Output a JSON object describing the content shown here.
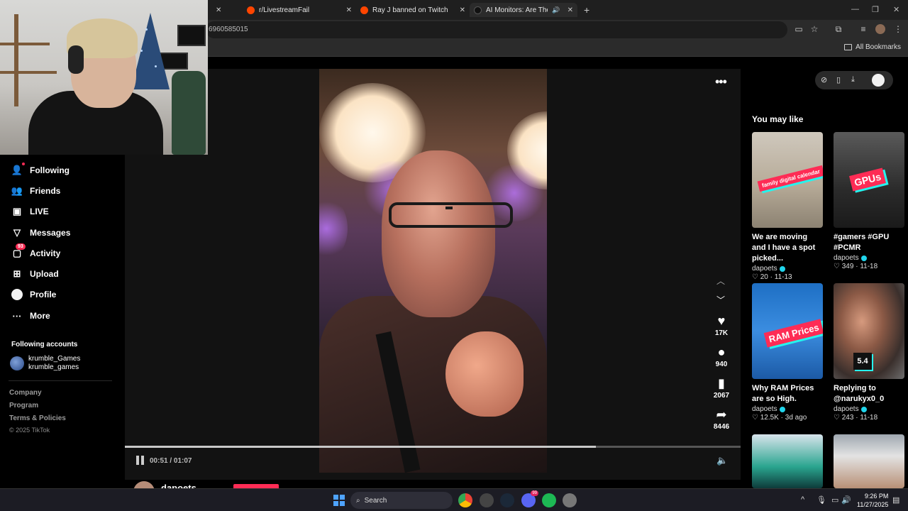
{
  "browser": {
    "tabs": [
      {
        "title": "r/LivestreamFail",
        "active": false
      },
      {
        "title": "Ray J banned on Twitch after us",
        "active": false
      },
      {
        "title": "AI Monitors: Are They a Con",
        "active": true
      }
    ],
    "url": "6960585015",
    "bookmarks_label": "All Bookmarks"
  },
  "sidebar": {
    "items": [
      {
        "label": "Following",
        "icon": "following-icon"
      },
      {
        "label": "Friends",
        "icon": "friends-icon"
      },
      {
        "label": "LIVE",
        "icon": "live-icon"
      },
      {
        "label": "Messages",
        "icon": "messages-icon"
      },
      {
        "label": "Activity",
        "icon": "activity-icon",
        "badge": "93"
      },
      {
        "label": "Upload",
        "icon": "upload-icon"
      },
      {
        "label": "Profile",
        "icon": "profile-icon"
      },
      {
        "label": "More",
        "icon": "more-icon"
      }
    ],
    "following_title": "Following accounts",
    "following_account": {
      "display_name": "krumble_Games",
      "username": "krumble_games"
    },
    "footer_links": [
      "Company",
      "Program",
      "Terms & Policies"
    ],
    "copyright": "© 2025 TikTok"
  },
  "video": {
    "actions": [
      {
        "name": "like",
        "count": "17K",
        "icon": "heart-icon"
      },
      {
        "name": "comment",
        "count": "940",
        "icon": "comment-icon"
      },
      {
        "name": "save",
        "count": "2067",
        "icon": "bookmark-icon"
      },
      {
        "name": "share",
        "count": "8446",
        "icon": "share-icon"
      }
    ],
    "time": "00:51 / 01:07",
    "progress": 0.765,
    "author": "dapoets"
  },
  "right_panel": {
    "title": "You may like",
    "cards": [
      {
        "thumb_text": "family digital calendar",
        "title": "We are moving and I have a spot picked...",
        "author": "dapoets",
        "likes": "20",
        "date": "11-13"
      },
      {
        "thumb_text": "GPUs",
        "title": "#gamers #GPU #PCMR",
        "author": "dapoets",
        "likes": "349",
        "date": "11-18"
      },
      {
        "thumb_text": "RAM Prices",
        "title": "Why RAM Prices are so High.",
        "author": "dapoets",
        "likes": "12.5K",
        "date": "3d ago"
      },
      {
        "thumb_text": "5.4",
        "title": "Replying to @narukyx0_0",
        "author": "dapoets",
        "likes": "243",
        "date": "11-18"
      }
    ]
  },
  "taskbar": {
    "search_placeholder": "Search",
    "time": "9:26 PM",
    "date": "11/27/2025",
    "discord_badge": "99"
  },
  "colors": {
    "accent": "#fe2c55",
    "cyan": "#25f4ee",
    "verified": "#20d5ec"
  }
}
